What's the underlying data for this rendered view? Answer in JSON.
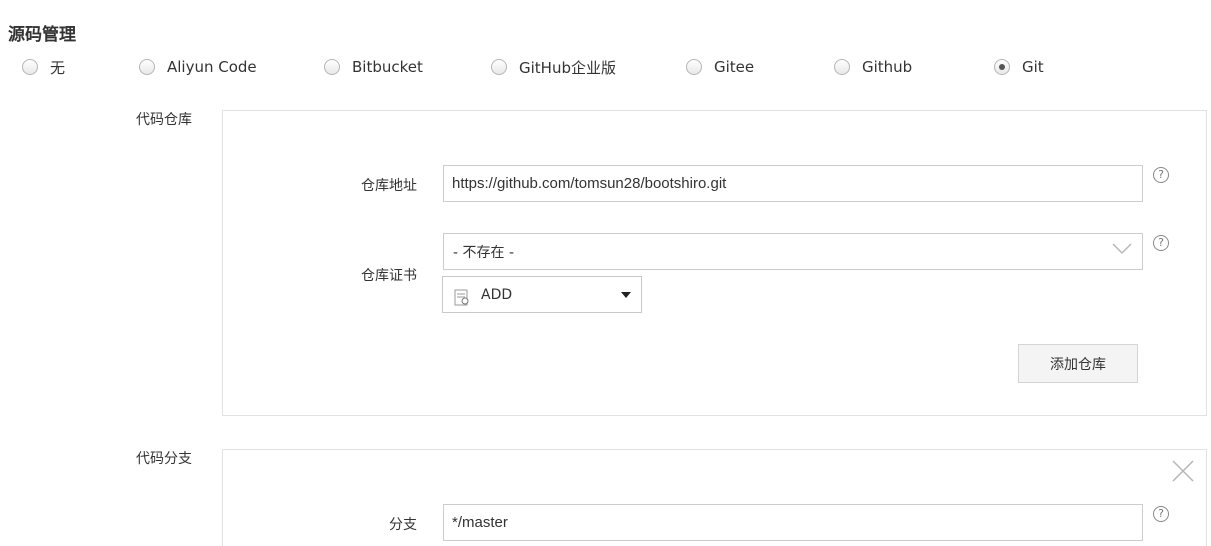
{
  "section": {
    "title": "源码管理"
  },
  "scm_options": [
    {
      "label": "无",
      "selected": false
    },
    {
      "label": "Aliyun Code",
      "selected": false
    },
    {
      "label": "Bitbucket",
      "selected": false
    },
    {
      "label": "GitHub企业版",
      "selected": false
    },
    {
      "label": "Gitee",
      "selected": false
    },
    {
      "label": "Github",
      "selected": false
    },
    {
      "label": "Git",
      "selected": true
    }
  ],
  "repo": {
    "section_label": "代码仓库",
    "url_label": "仓库地址",
    "url_value": "https://github.com/tomsun28/bootshiro.git",
    "cred_label": "仓库证书",
    "cred_value": "- 不存在 -",
    "add_label": "ADD",
    "add_repo_button": "添加仓库"
  },
  "branch": {
    "section_label": "代码分支",
    "branch_label": "分支",
    "branch_value": "*/master"
  },
  "help_glyph": "?",
  "icons": [
    "radio-icon",
    "help-icon",
    "chevron-down-icon",
    "credential-icon",
    "caret-down-icon",
    "close-icon"
  ]
}
